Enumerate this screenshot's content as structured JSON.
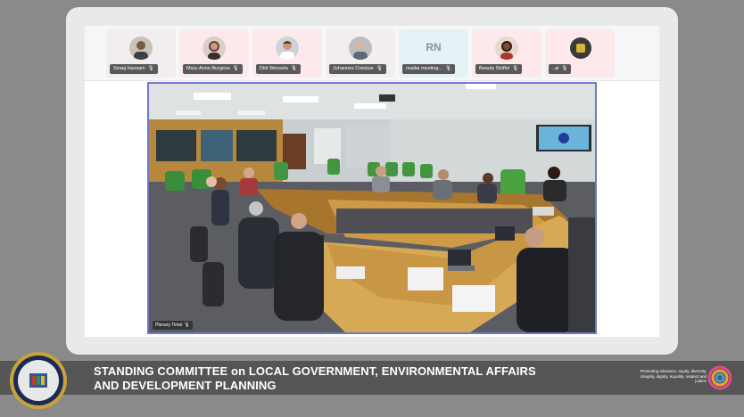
{
  "participants": [
    {
      "name": "Siraaj Hassam",
      "kind": "photo"
    },
    {
      "name": "Mary-Anne Burgess",
      "kind": "photo"
    },
    {
      "name": "Dirk Wessels",
      "kind": "photo"
    },
    {
      "name": "Johannes Coetzee",
      "kind": "photo"
    },
    {
      "name": "readai meeting...",
      "kind": "initials",
      "initials": "RN"
    },
    {
      "name": "Beauty Stoffel",
      "kind": "photo"
    },
    {
      "name": "..al",
      "kind": "emblem"
    }
  ],
  "main_video": {
    "label": "Plenary Timer"
  },
  "banner": {
    "title_line1": "STANDING COMMITTEE on LOCAL GOVERNMENT, ENVIRONMENTAL AFFAIRS",
    "title_line2": "AND DEVELOPMENT PLANNING",
    "tagline": "Promoting tolerance, equity, diversity, integrity, dignity, equality, respect and justice"
  },
  "colors": {
    "background": "#8a8a8a",
    "frame": "#e9e9ea",
    "video_border": "#6f78c8",
    "banner": "#555555"
  }
}
